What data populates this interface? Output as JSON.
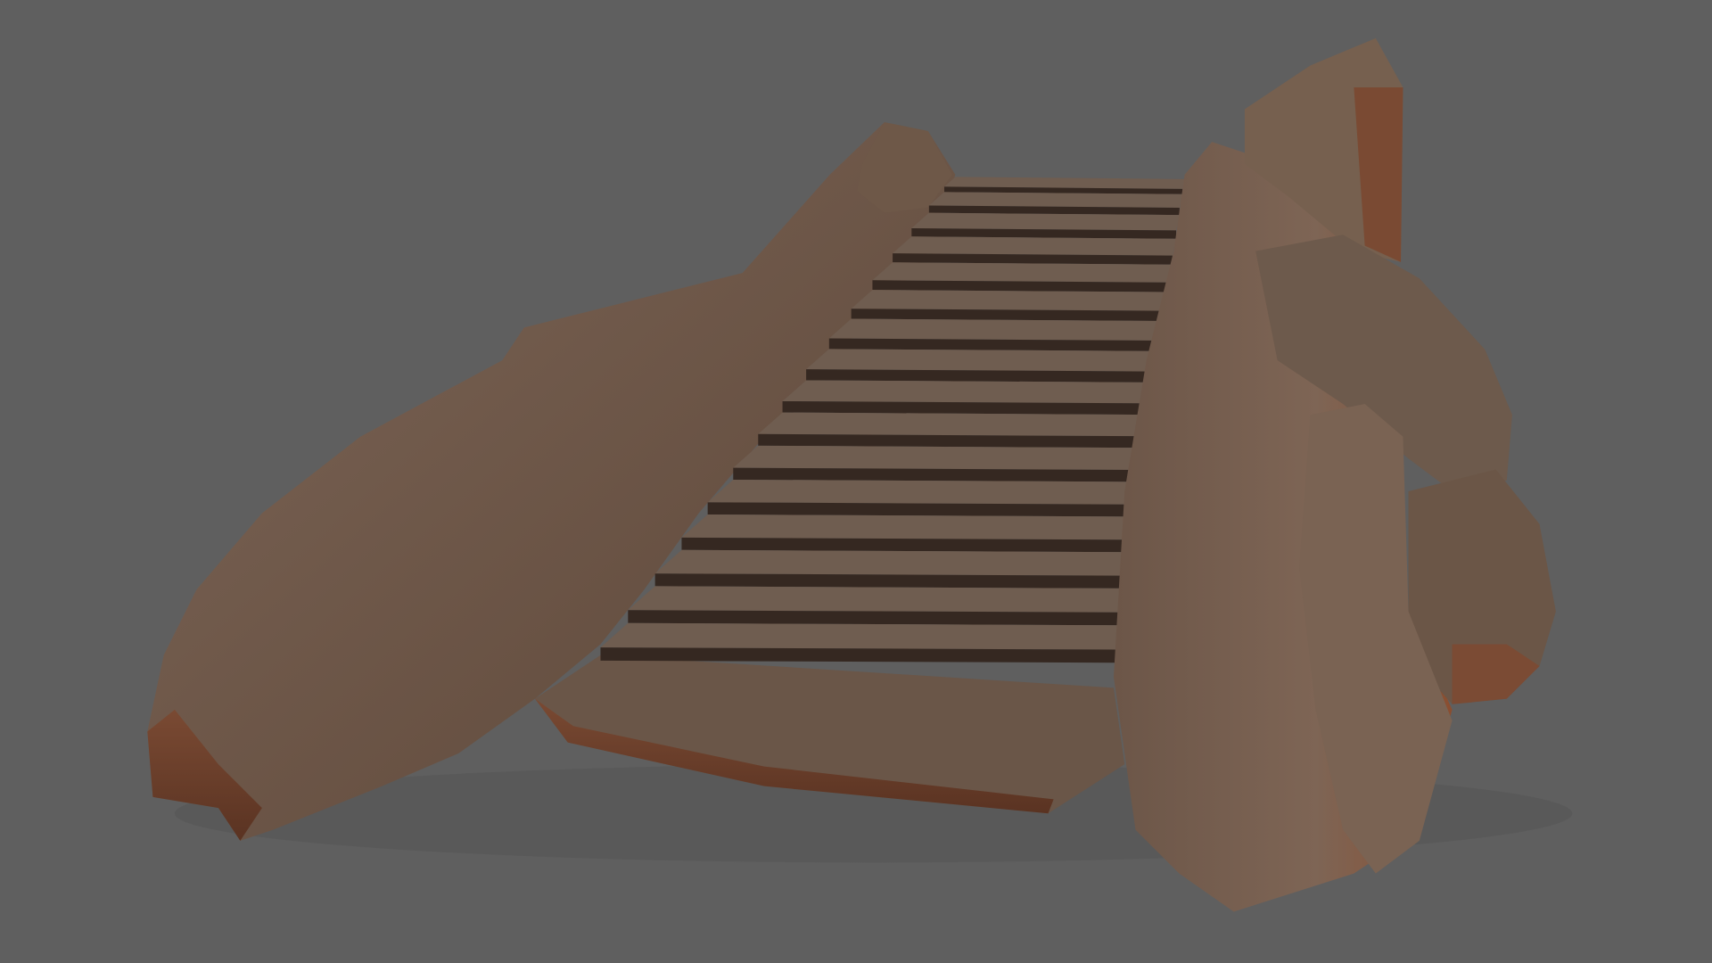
{
  "scene": {
    "subject": "stone-staircase",
    "step_count": 16,
    "colors": {
      "background": "#5f5f5f",
      "rock_light": "#7a6455",
      "rock_mid": "#65503f",
      "rock_dark": "#3e2f26",
      "rock_rust": "#8a4e30",
      "tread": "#6f5d50",
      "riser": "#352821"
    }
  }
}
